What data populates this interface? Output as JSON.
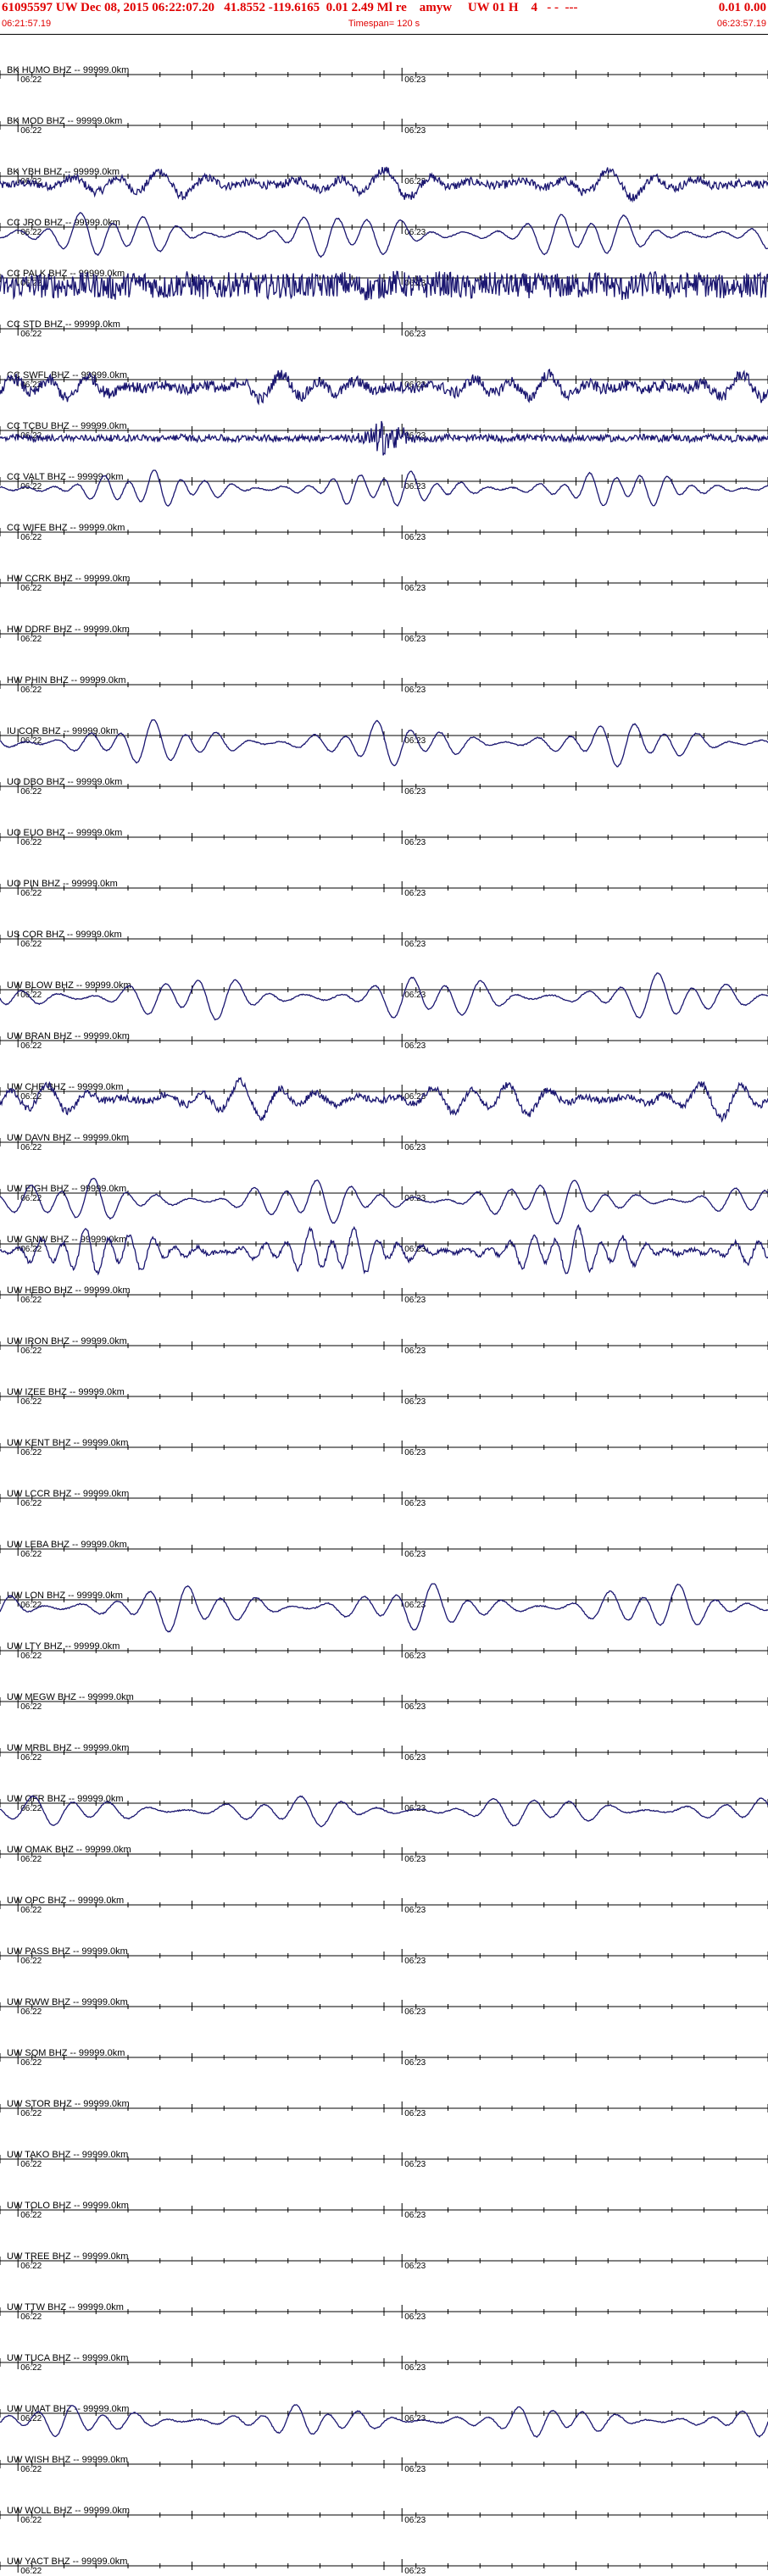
{
  "header": {
    "event_info": "61095597 UW Dec 08, 2015 06:22:07.20   41.8552 -119.6165  0.01 2.49 Ml re    amyw     UW 01 H    4   - -  ---",
    "event_right": "0.01 0.00",
    "start_time": "06:21:57.19",
    "timespan": "Timespan= 120 s",
    "end_time": "06:23:57.19"
  },
  "time_labels": [
    "06:22",
    "06:23"
  ],
  "colors": {
    "trace": "#1a1670",
    "header_text": "#e00000",
    "axis": "#000000",
    "label": "#000000"
  },
  "chart_data": {
    "type": "line",
    "x_unit": "s",
    "x_range": [
      0,
      120
    ],
    "channels": [
      {
        "label": "BK HUMO BHZ -- 99999.0km",
        "amplitude": 0,
        "period_s": 0,
        "noise": 0,
        "burst": 0
      },
      {
        "label": "BK MOD BHZ -- 99999.0km",
        "amplitude": 0,
        "period_s": 0,
        "noise": 0,
        "burst": 0
      },
      {
        "label": "BK YBH BHZ -- 99999.0km",
        "amplitude": 0.55,
        "period_s": 7,
        "noise": 0.15,
        "burst": 0
      },
      {
        "label": "CC JRO BHZ -- 99999.0km",
        "amplitude": 0.9,
        "period_s": 5,
        "noise": 0.02,
        "burst": 0
      },
      {
        "label": "CC PALK BHZ -- 99999.0km",
        "amplitude": 0.15,
        "period_s": 8,
        "noise": 0.45,
        "burst": 0
      },
      {
        "label": "CC STD BHZ -- 99999.0km",
        "amplitude": 0,
        "period_s": 0,
        "noise": 0,
        "burst": 0
      },
      {
        "label": "CC SWFL BHZ -- 99999.0km",
        "amplitude": 0.5,
        "period_s": 6,
        "noise": 0.2,
        "burst": 0
      },
      {
        "label": "CC TCBU BHZ -- 99999.0km",
        "amplitude": 0.05,
        "period_s": 6,
        "noise": 0.12,
        "burst": 0.6
      },
      {
        "label": "CC VALT BHZ -- 99999.0km",
        "amplitude": 0.7,
        "period_s": 4,
        "noise": 0.02,
        "burst": 0
      },
      {
        "label": "CC WIFE BHZ -- 99999.0km",
        "amplitude": 0,
        "period_s": 0,
        "noise": 0,
        "burst": 0
      },
      {
        "label": "HW CCRK BHZ -- 99999.0km",
        "amplitude": 0,
        "period_s": 0,
        "noise": 0,
        "burst": 0
      },
      {
        "label": "HW DDRF BHZ -- 99999.0km",
        "amplitude": 0,
        "period_s": 0,
        "noise": 0,
        "burst": 0
      },
      {
        "label": "HW PHIN BHZ -- 99999.0km",
        "amplitude": 0,
        "period_s": 0,
        "noise": 0,
        "burst": 0
      },
      {
        "label": "IU COR BHZ -- 99999.0km",
        "amplitude": 0.85,
        "period_s": 5,
        "noise": 0.02,
        "burst": 0
      },
      {
        "label": "UO DBO BHZ -- 99999.0km",
        "amplitude": 0,
        "period_s": 0,
        "noise": 0,
        "burst": 0
      },
      {
        "label": "UO EUO BHZ -- 99999.0km",
        "amplitude": 0,
        "period_s": 0,
        "noise": 0,
        "burst": 0
      },
      {
        "label": "UO PIN BHZ -- 99999.0km",
        "amplitude": 0,
        "period_s": 0,
        "noise": 0,
        "burst": 0
      },
      {
        "label": "US COR BHZ -- 99999.0km",
        "amplitude": 0,
        "period_s": 0,
        "noise": 0,
        "burst": 0
      },
      {
        "label": "UW BLOW BHZ -- 99999.0km",
        "amplitude": 0.9,
        "period_s": 5.5,
        "noise": 0.02,
        "burst": 0
      },
      {
        "label": "UW BRAN BHZ -- 99999.0km",
        "amplitude": 0,
        "period_s": 0,
        "noise": 0,
        "burst": 0
      },
      {
        "label": "UW CHE BHZ -- 99999.0km",
        "amplitude": 0.7,
        "period_s": 6,
        "noise": 0.12,
        "burst": 0
      },
      {
        "label": "UW DAVN BHZ -- 99999.0km",
        "amplitude": 0,
        "period_s": 0,
        "noise": 0,
        "burst": 0
      },
      {
        "label": "UW EIGH BHZ -- 99999.0km",
        "amplitude": 0.85,
        "period_s": 5,
        "noise": 0.02,
        "burst": 0
      },
      {
        "label": "UW GNW BHZ -- 99999.0km",
        "amplitude": 0.9,
        "period_s": 3.5,
        "noise": 0.08,
        "burst": 0
      },
      {
        "label": "UW HEBO BHZ -- 99999.0km",
        "amplitude": 0,
        "period_s": 0,
        "noise": 0,
        "burst": 0
      },
      {
        "label": "UW IRON BHZ -- 99999.0km",
        "amplitude": 0,
        "period_s": 0,
        "noise": 0,
        "burst": 0
      },
      {
        "label": "UW IZEE BHZ -- 99999.0km",
        "amplitude": 0,
        "period_s": 0,
        "noise": 0,
        "burst": 0
      },
      {
        "label": "UW KENT BHZ -- 99999.0km",
        "amplitude": 0,
        "period_s": 0,
        "noise": 0,
        "burst": 0
      },
      {
        "label": "UW LCCR BHZ -- 99999.0km",
        "amplitude": 0,
        "period_s": 0,
        "noise": 0,
        "burst": 0
      },
      {
        "label": "UW LEBA BHZ -- 99999.0km",
        "amplitude": 0,
        "period_s": 0,
        "noise": 0,
        "burst": 0
      },
      {
        "label": "UW LON BHZ -- 99999.0km",
        "amplitude": 0.9,
        "period_s": 5.5,
        "noise": 0.02,
        "burst": 0
      },
      {
        "label": "UW LTY BHZ -- 99999.0km",
        "amplitude": 0,
        "period_s": 0,
        "noise": 0,
        "burst": 0
      },
      {
        "label": "UW MEGW BHZ -- 99999.0km",
        "amplitude": 0,
        "period_s": 0,
        "noise": 0,
        "burst": 0
      },
      {
        "label": "UW MRBL BHZ -- 99999.0km",
        "amplitude": 0,
        "period_s": 0,
        "noise": 0,
        "burst": 0
      },
      {
        "label": "UW OFR BHZ -- 99999.0km",
        "amplitude": 0.6,
        "period_s": 6,
        "noise": 0.02,
        "burst": 0
      },
      {
        "label": "UW OMAK BHZ -- 99999.0km",
        "amplitude": 0,
        "period_s": 0,
        "noise": 0,
        "burst": 0
      },
      {
        "label": "UW OPC BHZ -- 99999.0km",
        "amplitude": 0,
        "period_s": 0,
        "noise": 0,
        "burst": 0
      },
      {
        "label": "UW PASS BHZ -- 99999.0km",
        "amplitude": 0,
        "period_s": 0,
        "noise": 0,
        "burst": 0
      },
      {
        "label": "UW RWW BHZ -- 99999.0km",
        "amplitude": 0,
        "period_s": 0,
        "noise": 0,
        "burst": 0
      },
      {
        "label": "UW SQM BHZ -- 99999.0km",
        "amplitude": 0,
        "period_s": 0,
        "noise": 0,
        "burst": 0
      },
      {
        "label": "UW STOR BHZ -- 99999.0km",
        "amplitude": 0,
        "period_s": 0,
        "noise": 0,
        "burst": 0
      },
      {
        "label": "UW TAKO BHZ -- 99999.0km",
        "amplitude": 0,
        "period_s": 0,
        "noise": 0,
        "burst": 0
      },
      {
        "label": "UW TOLO BHZ -- 99999.0km",
        "amplitude": 0,
        "period_s": 0,
        "noise": 0,
        "burst": 0
      },
      {
        "label": "UW TREE BHZ -- 99999.0km",
        "amplitude": 0,
        "period_s": 0,
        "noise": 0,
        "burst": 0
      },
      {
        "label": "UW TTW BHZ -- 99999.0km",
        "amplitude": 0,
        "period_s": 0,
        "noise": 0,
        "burst": 0
      },
      {
        "label": "UW TUCA BHZ -- 99999.0km",
        "amplitude": 0,
        "period_s": 0,
        "noise": 0,
        "burst": 0
      },
      {
        "label": "UW UMAT BHZ -- 99999.0km",
        "amplitude": 0.6,
        "period_s": 5,
        "noise": 0.02,
        "burst": 0
      },
      {
        "label": "UW WISH BHZ -- 99999.0km",
        "amplitude": 0,
        "period_s": 0,
        "noise": 0,
        "burst": 0
      },
      {
        "label": "UW WOLL BHZ -- 99999.0km",
        "amplitude": 0,
        "period_s": 0,
        "noise": 0,
        "burst": 0
      },
      {
        "label": "UW YACT BHZ -- 99999.0km",
        "amplitude": 0,
        "period_s": 0,
        "noise": 0,
        "burst": 0
      }
    ]
  }
}
